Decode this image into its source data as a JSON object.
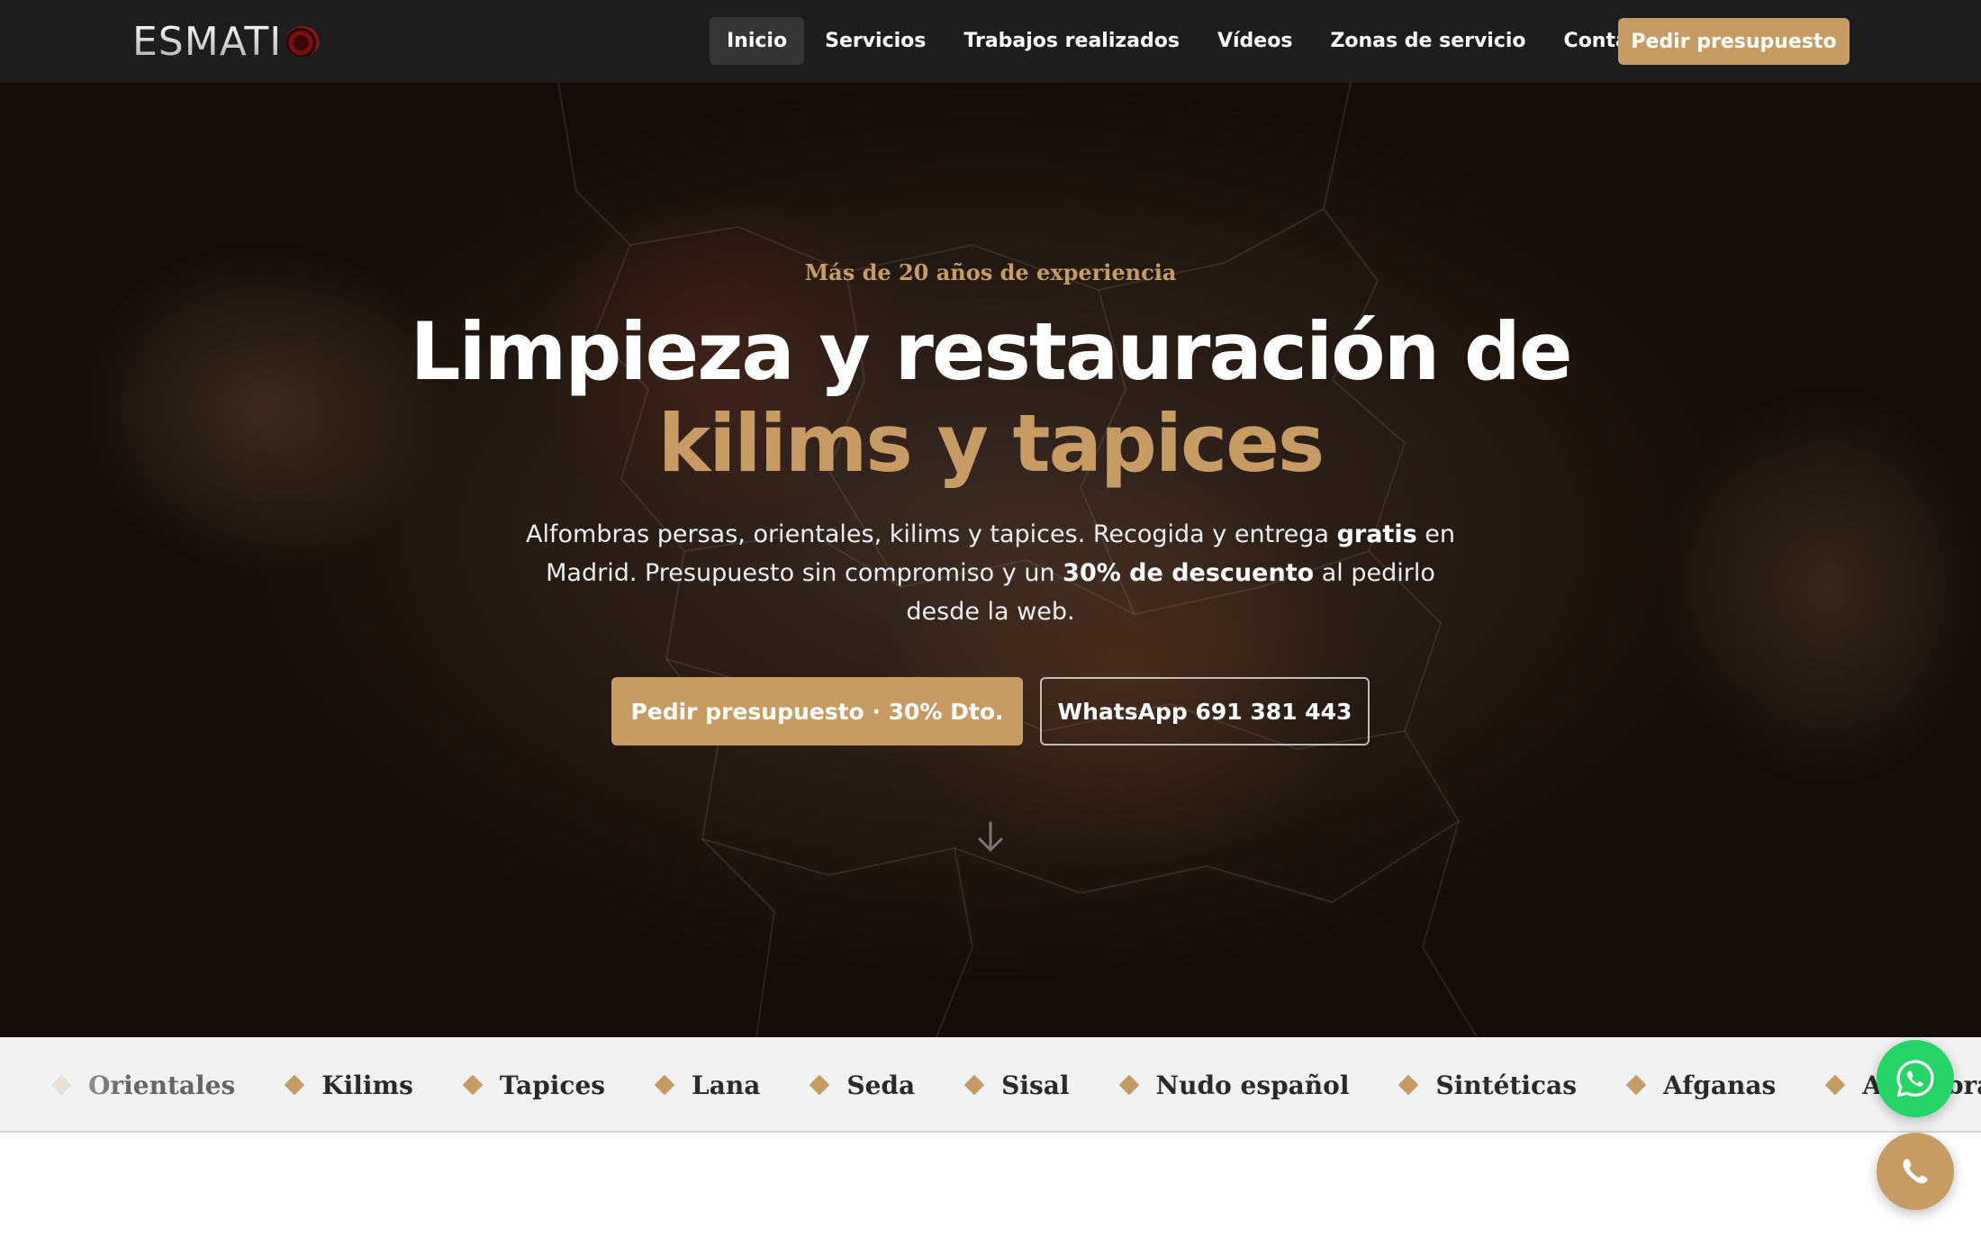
{
  "header": {
    "logo_text": "ESMATI",
    "nav": [
      {
        "label": "Inicio",
        "active": true
      },
      {
        "label": "Servicios",
        "active": false
      },
      {
        "label": "Trabajos realizados",
        "active": false
      },
      {
        "label": "Vídeos",
        "active": false
      },
      {
        "label": "Zonas de servicio",
        "active": false
      },
      {
        "label": "Contacto",
        "active": false
      }
    ],
    "cta_label": "Pedir presupuesto"
  },
  "hero": {
    "eyebrow": "Más de 20 años de experiencia",
    "headline_line1": "Limpieza y restauración de",
    "headline_accent": "kilims y tapices",
    "subtext": {
      "part1": "Alfombras persas, orientales, kilims y tapices. Recogida y entrega ",
      "bold1": "gratis",
      "part2": " en Madrid. Presupuesto sin compromiso y un ",
      "bold2": "30% de descuento",
      "part3": " al pedirlo desde la web."
    },
    "primary_button": "Pedir presupuesto · 30% Dto.",
    "secondary_button": "WhatsApp 691 381 443",
    "scroll_icon": "arrow-down-icon"
  },
  "strip": {
    "items": [
      "Orientales",
      "Kilims",
      "Tapices",
      "Lana",
      "Seda",
      "Sisal",
      "Nudo español",
      "Sintéticas",
      "Afganas",
      "Alfombras pe"
    ]
  },
  "floating": {
    "whatsapp_icon": "whatsapp-icon",
    "phone_icon": "phone-icon"
  },
  "colors": {
    "accent": "#c69c64",
    "header_bg": "#1d1d1d",
    "whatsapp_green": "#25d366",
    "strip_bg": "#f2f2f2"
  }
}
